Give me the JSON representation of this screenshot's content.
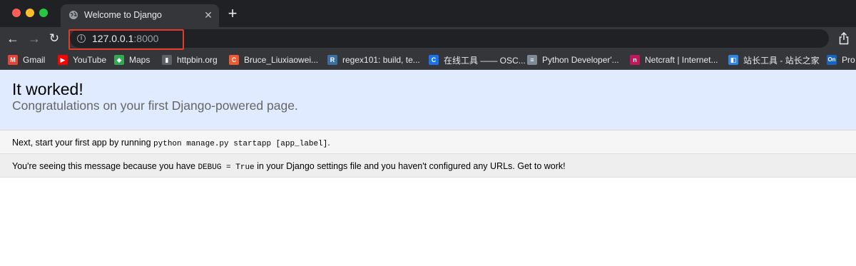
{
  "browser": {
    "tab": {
      "title": "Welcome to Django",
      "close_glyph": "✕"
    },
    "new_tab_glyph": "+",
    "nav": {
      "back_glyph": "←",
      "forward_glyph": "→",
      "reload_glyph": "↻"
    },
    "address": {
      "host": "127.0.0.1",
      "port": ":8000",
      "info_glyph": "i"
    },
    "bookmarks": [
      {
        "label": "Gmail",
        "icon": "gmail-icon",
        "color": "#ea4335",
        "glyph": "M"
      },
      {
        "label": "YouTube",
        "icon": "youtube-icon",
        "color": "#ff0000",
        "glyph": "▶"
      },
      {
        "label": "Maps",
        "icon": "maps-icon",
        "color": "#34a853",
        "glyph": "◆"
      },
      {
        "label": "httpbin.org",
        "icon": "trash-icon",
        "color": "#5f6368",
        "glyph": "▮"
      },
      {
        "label": "Bruce_Liuxiaowei...",
        "icon": "csdn-icon",
        "color": "#f05a30",
        "glyph": "C"
      },
      {
        "label": "regex101: build, te...",
        "icon": "regex101-icon",
        "color": "#3a6ea5",
        "glyph": "R"
      },
      {
        "label": "在线工具 —— OSC...",
        "icon": "oschina-icon",
        "color": "#1a73e8",
        "glyph": "C"
      },
      {
        "label": "Python Developer'...",
        "icon": "document-icon",
        "color": "#7f8a99",
        "glyph": "≡"
      },
      {
        "label": "Netcraft | Internet...",
        "icon": "netcraft-icon",
        "color": "#c2185b",
        "glyph": "n"
      },
      {
        "label": "站长工具 - 站长之家",
        "icon": "chinaz-icon",
        "color": "#2e86de",
        "glyph": "◧"
      },
      {
        "label": "Pro",
        "icon": "on-icon",
        "color": "#1565c0",
        "glyph": "On"
      }
    ]
  },
  "page": {
    "title": "It worked!",
    "subtitle": "Congratulations on your first Django-powered page.",
    "instructions": {
      "before": "Next, start your first app by running ",
      "code": "python manage.py startapp [app_label]",
      "after": "."
    },
    "explanation": {
      "before": "You're seeing this message because you have ",
      "code": "DEBUG = True",
      "after": " in your Django settings file and you haven't configured any URLs. Get to work!"
    }
  }
}
